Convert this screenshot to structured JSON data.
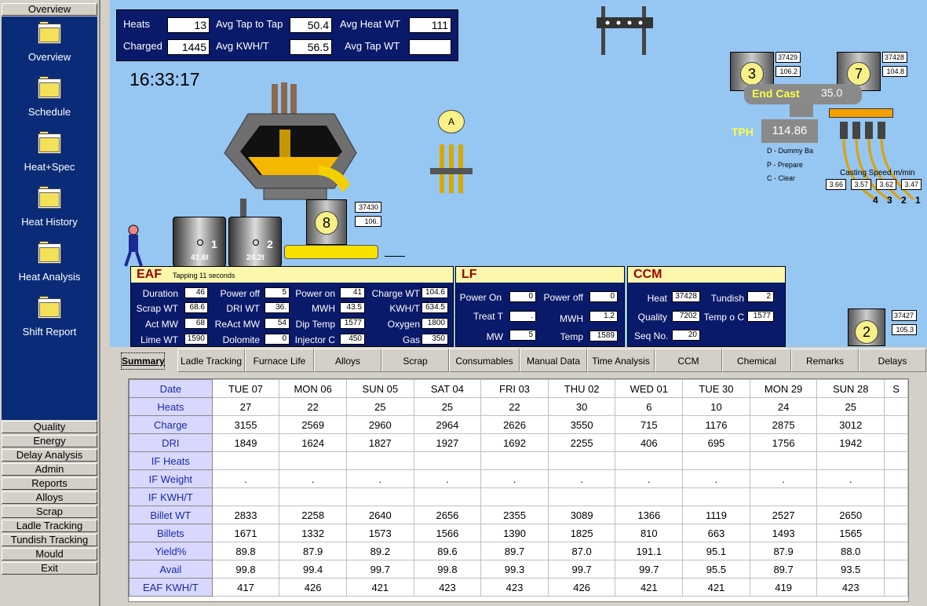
{
  "nav": {
    "top_button": "Overview",
    "icons": [
      "Overview",
      "Schedule",
      "Heat+Spec",
      "Heat History",
      "Heat Analysis",
      "Shift Report"
    ],
    "buttons": [
      "Quality",
      "Energy",
      "Delay Analysis",
      "Admin",
      "Reports",
      "Alloys",
      "Scrap",
      "Ladle Tracking",
      "Tundish Tracking",
      "Mould",
      "Exit"
    ]
  },
  "stats": {
    "heats_label": "Heats",
    "heats": "13",
    "charged_label": "Charged",
    "charged": "1445",
    "avg_tap_label": "Avg Tap to Tap",
    "avg_tap": "50.4",
    "avg_kwh_label": "Avg KWH/T",
    "avg_kwh": "56.5",
    "avg_heat_wt_label": "Avg Heat WT",
    "avg_heat_wt": "111",
    "avg_tap_wt_label": "Avg Tap WT",
    "avg_tap_wt": ""
  },
  "clock": "16:33:17",
  "scene": {
    "ladle1_num": "1",
    "ladle1_wt": "41.6t",
    "ladle2_num": "2",
    "ladle2_wt": "24.2t",
    "ladle8_num": "8",
    "ladle8_heat": "37430",
    "ladle8_val": "106.",
    "lf_station": "A",
    "ccm_ladle3": "3",
    "ccm_ladle3_heat": "37429",
    "ccm_ladle3_val": "106.2",
    "ccm_ladle7": "7",
    "ccm_ladle7_heat": "37428",
    "ccm_ladle7_val": "104.8",
    "end_cast_label": "End Cast",
    "end_cast_val": "35.0",
    "tph_label": "TPH",
    "tph_val": "114.86",
    "legend": [
      "D - Dummy Ba",
      "P - Prepare",
      "C - Clear"
    ],
    "casting_speed_label": "Casting Speed m/min",
    "casting_speeds": [
      "3.66",
      "3.57",
      "3.62",
      "3.47"
    ],
    "strands": [
      "4",
      "3",
      "2",
      "1"
    ],
    "ladle2_heat": "37427",
    "ladle2_val": "105.3"
  },
  "eaf": {
    "title": "EAF",
    "status": "Tapping 11 seconds",
    "fields": [
      [
        "Duration",
        "46"
      ],
      [
        "Power off",
        "5"
      ],
      [
        "Power on",
        "41"
      ],
      [
        "Charge WT",
        "104.6"
      ],
      [
        "Scrap WT",
        "68.6"
      ],
      [
        "DRI WT",
        "36."
      ],
      [
        "MWH",
        "43.5"
      ],
      [
        "KWH/T",
        "634.5"
      ],
      [
        "Act MW",
        "68"
      ],
      [
        "ReAct MW",
        "54"
      ],
      [
        "Dip Temp",
        "1577"
      ],
      [
        "Oxygen",
        "1800"
      ],
      [
        "Lime WT",
        "1590"
      ],
      [
        "Dolomite",
        "0"
      ],
      [
        "Injector C",
        "450"
      ],
      [
        "Gas",
        "350"
      ]
    ]
  },
  "lf": {
    "title": "LF",
    "fields": [
      [
        "Power On",
        "0"
      ],
      [
        "Power off",
        "0"
      ],
      [
        "Treat T",
        "."
      ],
      [
        "MWH",
        "1.2"
      ],
      [
        "MW",
        "5"
      ],
      [
        "Temp",
        "1589"
      ]
    ]
  },
  "ccm": {
    "title": "CCM",
    "fields": [
      [
        "Heat",
        "37428"
      ],
      [
        "Tundish",
        "2"
      ],
      [
        "Quality",
        "7202"
      ],
      [
        "Temp o C",
        "1577"
      ],
      [
        "Seq No.",
        "20"
      ]
    ]
  },
  "tabs": [
    "Summary",
    "Ladle Tracking",
    "Furnace Life",
    "Alloys Additions",
    "Scrap",
    "Consumables",
    "Manual Data",
    "Time Analysis",
    "CCM",
    "Chemical Analysis",
    "Remarks",
    "Delays"
  ],
  "table": {
    "columns": [
      "TUE 07",
      "MON 06",
      "SUN 05",
      "SAT 04",
      "FRI 03",
      "THU 02",
      "WED 01",
      "TUE 30",
      "MON 29",
      "SUN 28",
      "S"
    ],
    "rows": [
      {
        "label": "Date",
        "values": []
      },
      {
        "label": "Heats",
        "values": [
          "27",
          "22",
          "25",
          "25",
          "22",
          "30",
          "6",
          "10",
          "24",
          "25",
          ""
        ]
      },
      {
        "label": "Charge",
        "values": [
          "3155",
          "2569",
          "2960",
          "2964",
          "2626",
          "3550",
          "715",
          "1176",
          "2875",
          "3012",
          ""
        ]
      },
      {
        "label": "DRI",
        "values": [
          "1849",
          "1624",
          "1827",
          "1927",
          "1692",
          "2255",
          "406",
          "695",
          "1756",
          "1942",
          ""
        ]
      },
      {
        "label": "IF Heats",
        "values": [
          "",
          "",
          "",
          "",
          "",
          "",
          "",
          "",
          "",
          "",
          ""
        ]
      },
      {
        "label": "IF Weight",
        "values": [
          ".",
          ".",
          ".",
          ".",
          ".",
          ".",
          ".",
          ".",
          ".",
          ".",
          ""
        ]
      },
      {
        "label": "IF KWH/T",
        "values": [
          "",
          "",
          "",
          "",
          "",
          "",
          "",
          "",
          "",
          "",
          ""
        ]
      },
      {
        "label": "Billet WT",
        "values": [
          "2833",
          "2258",
          "2640",
          "2656",
          "2355",
          "3089",
          "1366",
          "1119",
          "2527",
          "2650",
          ""
        ]
      },
      {
        "label": "Billets",
        "values": [
          "1671",
          "1332",
          "1573",
          "1566",
          "1390",
          "1825",
          "810",
          "663",
          "1493",
          "1565",
          ""
        ]
      },
      {
        "label": "Yield%",
        "values": [
          "89.8",
          "87.9",
          "89.2",
          "89.6",
          "89.7",
          "87.0",
          "191.1",
          "95.1",
          "87.9",
          "88.0",
          ""
        ]
      },
      {
        "label": "Avail",
        "values": [
          "99.8",
          "99.4",
          "99.7",
          "99.8",
          "99.3",
          "99.7",
          "99.7",
          "95.5",
          "89.7",
          "93.5",
          ""
        ]
      },
      {
        "label": "EAF KWH/T",
        "values": [
          "417",
          "426",
          "421",
          "423",
          "423",
          "426",
          "421",
          "421",
          "419",
          "423",
          ""
        ]
      }
    ]
  }
}
